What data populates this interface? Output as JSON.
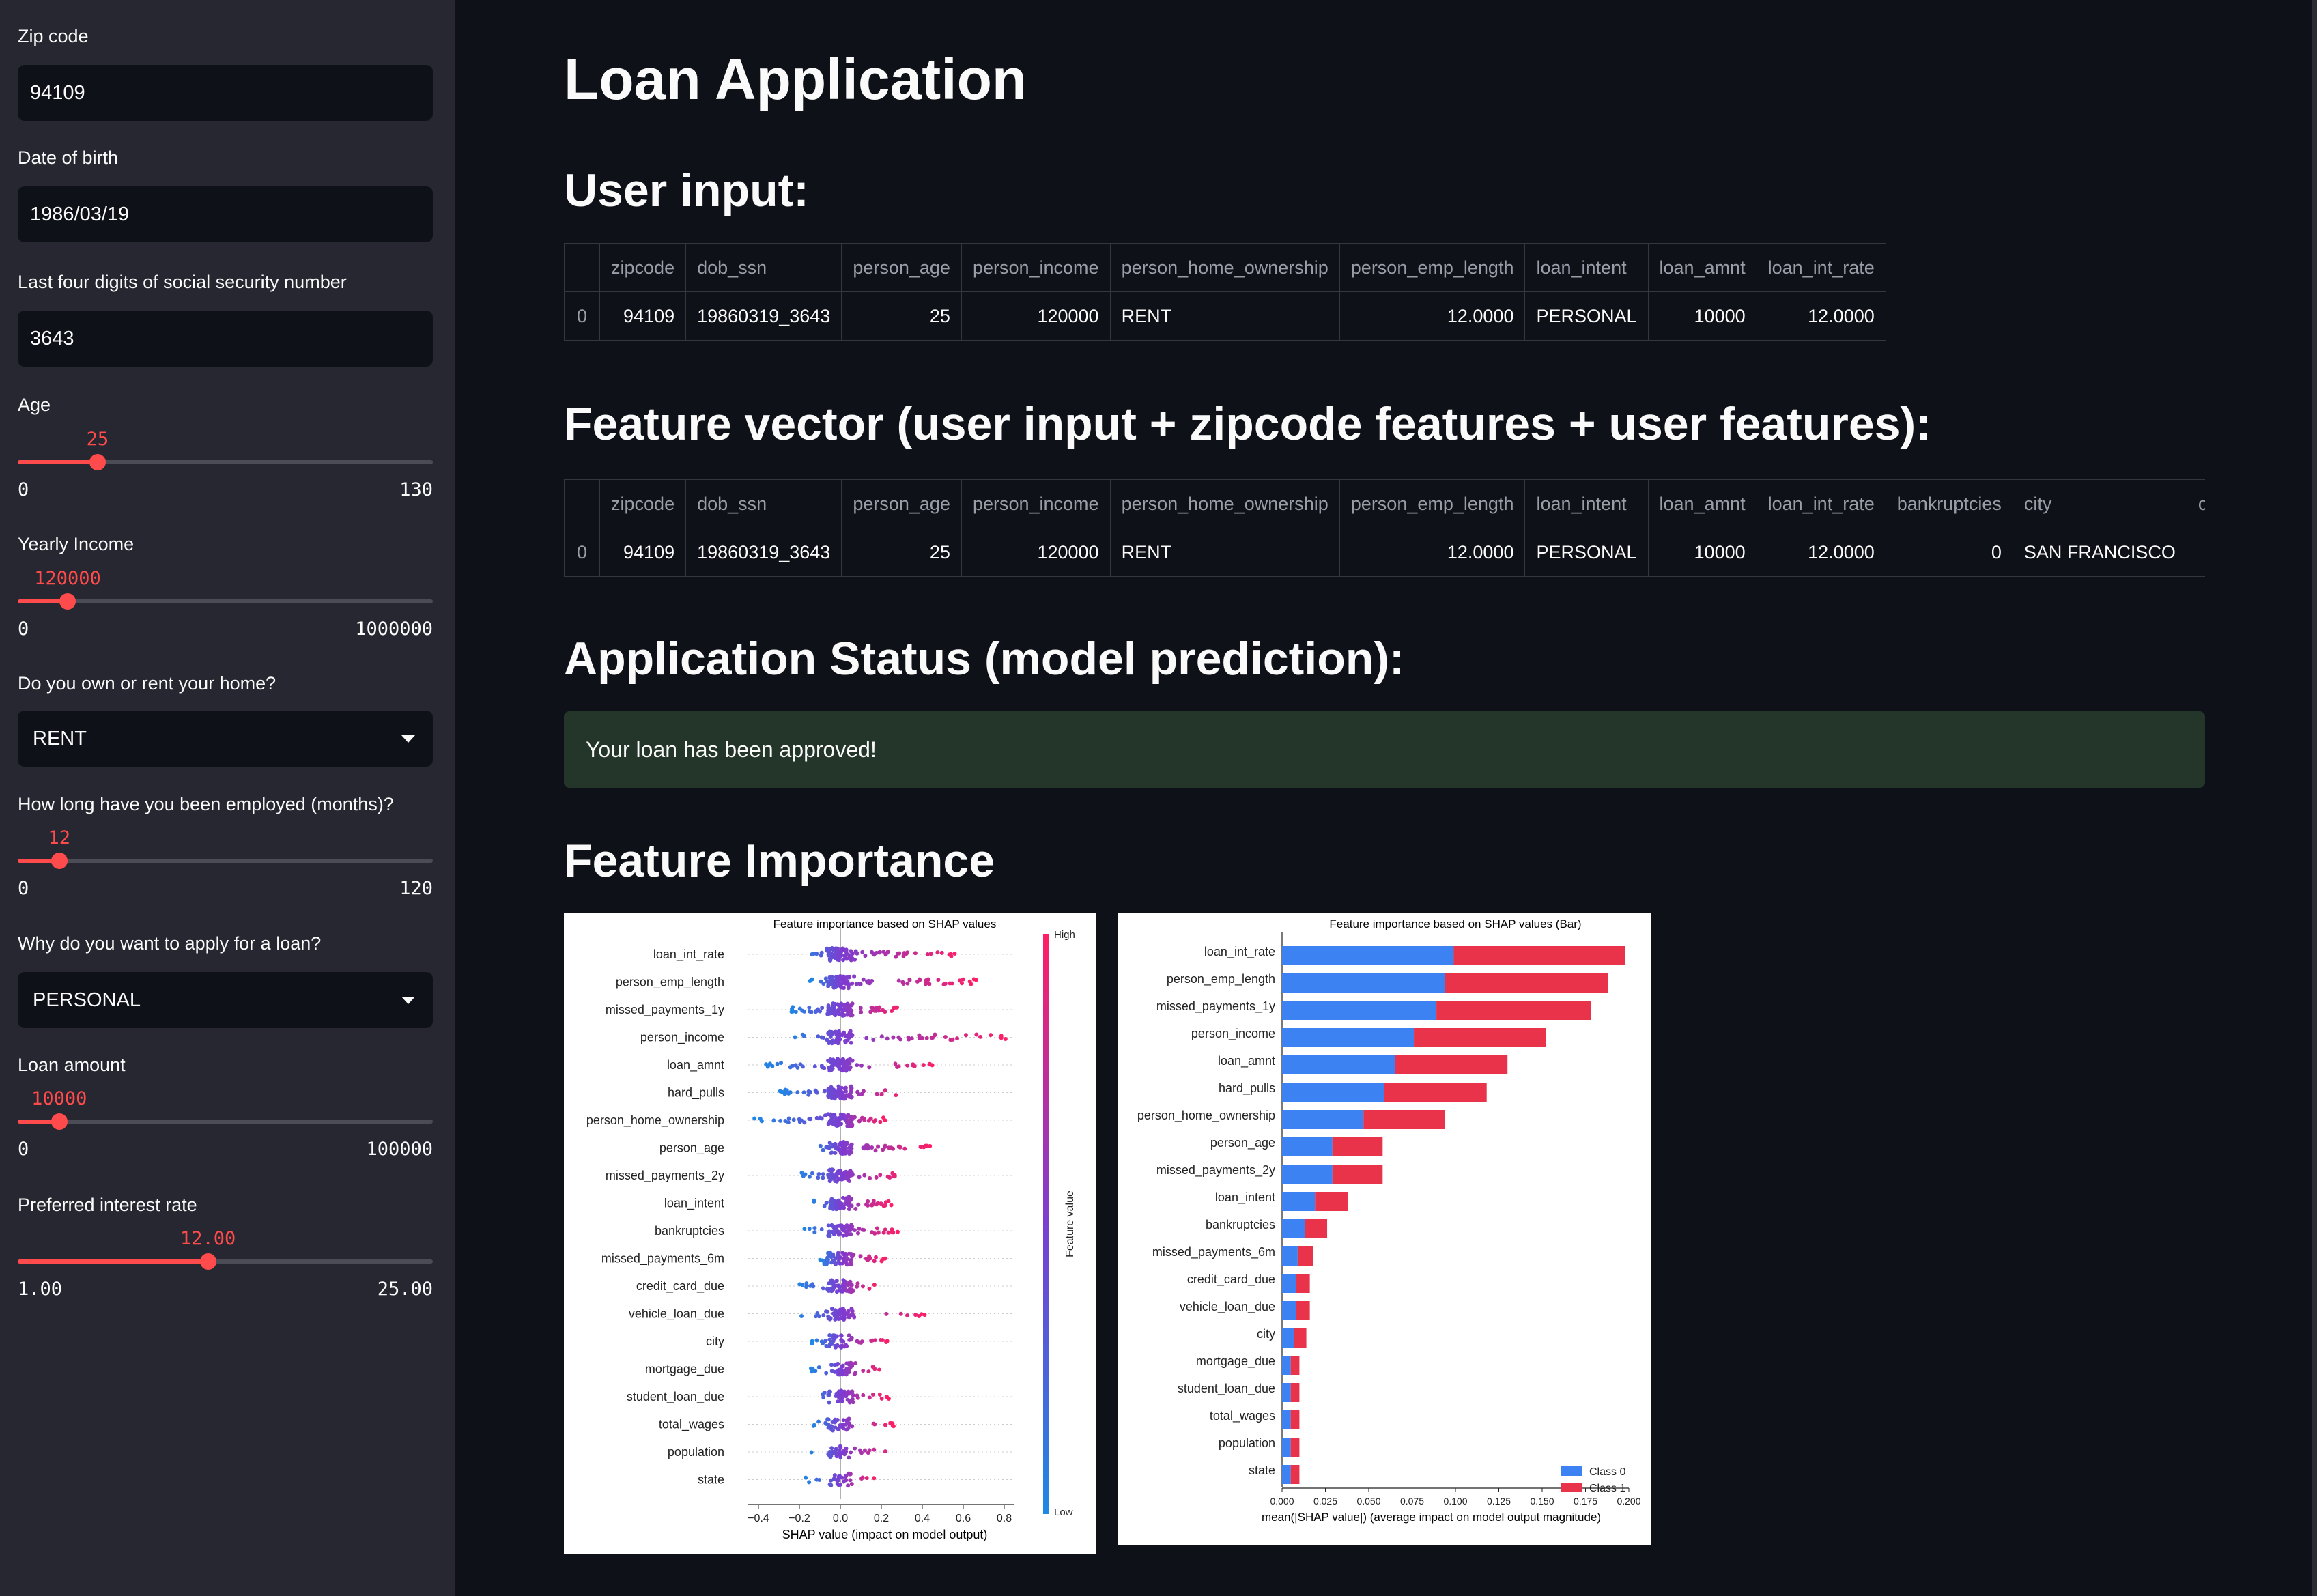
{
  "sidebar": {
    "zip": {
      "label": "Zip code",
      "value": "94109"
    },
    "dob": {
      "label": "Date of birth",
      "value": "1986/03/19"
    },
    "ssn": {
      "label": "Last four digits of social security number",
      "value": "3643"
    },
    "age": {
      "label": "Age",
      "value": "25",
      "min": "0",
      "max": "130",
      "fraction": 0.1923
    },
    "income": {
      "label": "Yearly Income",
      "value": "120000",
      "min": "0",
      "max": "1000000",
      "fraction": 0.12
    },
    "home": {
      "label": "Do you own or rent your home?",
      "value": "RENT"
    },
    "employed": {
      "label": "How long have you been employed (months)?",
      "value": "12",
      "min": "0",
      "max": "120",
      "fraction": 0.1
    },
    "intent": {
      "label": "Why do you want to apply for a loan?",
      "value": "PERSONAL"
    },
    "loan": {
      "label": "Loan amount",
      "value": "10000",
      "min": "0",
      "max": "100000",
      "fraction": 0.1
    },
    "rate": {
      "label": "Preferred interest rate",
      "value": "12.00",
      "min": "1.00",
      "max": "25.00",
      "fraction": 0.4583
    }
  },
  "main": {
    "title": "Loan Application",
    "user_input_heading": "User input:",
    "feature_vector_heading": "Feature vector (user input + zipcode features + user features):",
    "status_heading": "Application Status (model prediction):",
    "status_message": "Your loan has been approved!",
    "importance_heading": "Feature Importance"
  },
  "user_table": {
    "columns": [
      "",
      "zipcode",
      "dob_ssn",
      "person_age",
      "person_income",
      "person_home_ownership",
      "person_emp_length",
      "loan_intent",
      "loan_amnt",
      "loan_int_rate"
    ],
    "rows": [
      [
        "0",
        "94109",
        "19860319_3643",
        "25",
        "120000",
        "RENT",
        "12.0000",
        "PERSONAL",
        "10000",
        "12.0000"
      ]
    ]
  },
  "feature_table": {
    "columns": [
      "",
      "zipcode",
      "dob_ssn",
      "person_age",
      "person_income",
      "person_home_ownership",
      "person_emp_length",
      "loan_intent",
      "loan_amnt",
      "loan_int_rate",
      "bankruptcies",
      "city",
      "credit"
    ],
    "rows": [
      [
        "0",
        "94109",
        "19860319_3643",
        "25",
        "120000",
        "RENT",
        "12.0000",
        "PERSONAL",
        "10000",
        "12.0000",
        "0",
        "SAN FRANCISCO",
        ""
      ]
    ]
  },
  "colors": {
    "accent": "#ff4b4b",
    "class0": "#3c82f2",
    "class1": "#e8334a",
    "success_bg": "#233629"
  },
  "chart_data": [
    {
      "type": "scatter",
      "title": "Feature importance based on SHAP values",
      "xlabel": "SHAP value (impact on model output)",
      "xlim": [
        -0.45,
        0.85
      ],
      "xticks": [
        "−0.4",
        "−0.2",
        "0.0",
        "0.2",
        "0.4",
        "0.6",
        "0.8"
      ],
      "colorbar_label": "Feature value",
      "colorbar_high": "High",
      "colorbar_low": "Low",
      "features": [
        "loan_int_rate",
        "person_emp_length",
        "missed_payments_1y",
        "person_income",
        "loan_amnt",
        "hard_pulls",
        "person_home_ownership",
        "person_age",
        "missed_payments_2y",
        "loan_intent",
        "bankruptcies",
        "missed_payments_6m",
        "credit_card_due",
        "vehicle_loan_due",
        "city",
        "mortgage_due",
        "student_loan_due",
        "total_wages",
        "population",
        "state"
      ],
      "spread": [
        [
          -0.2,
          0.6
        ],
        [
          -0.15,
          0.67
        ],
        [
          -0.25,
          0.3
        ],
        [
          -0.25,
          0.82
        ],
        [
          -0.38,
          0.46
        ],
        [
          -0.3,
          0.32
        ],
        [
          -0.42,
          0.22
        ],
        [
          -0.15,
          0.45
        ],
        [
          -0.22,
          0.32
        ],
        [
          -0.15,
          0.26
        ],
        [
          -0.18,
          0.28
        ],
        [
          -0.1,
          0.22
        ],
        [
          -0.22,
          0.18
        ],
        [
          -0.22,
          0.43
        ],
        [
          -0.14,
          0.24
        ],
        [
          -0.15,
          0.22
        ],
        [
          -0.16,
          0.24
        ],
        [
          -0.14,
          0.26
        ],
        [
          -0.16,
          0.3
        ],
        [
          -0.18,
          0.17
        ]
      ]
    },
    {
      "type": "bar",
      "title": "Feature importance based on SHAP values (Bar)",
      "xlabel": "mean(|SHAP value|) (average impact on model output magnitude)",
      "xlim": [
        0,
        0.2
      ],
      "xticks": [
        "0.000",
        "0.025",
        "0.050",
        "0.075",
        "0.100",
        "0.125",
        "0.150",
        "0.175",
        "0.200"
      ],
      "categories": [
        "loan_int_rate",
        "person_emp_length",
        "missed_payments_1y",
        "person_income",
        "loan_amnt",
        "hard_pulls",
        "person_home_ownership",
        "person_age",
        "missed_payments_2y",
        "loan_intent",
        "bankruptcies",
        "missed_payments_6m",
        "credit_card_due",
        "vehicle_loan_due",
        "city",
        "mortgage_due",
        "student_loan_due",
        "total_wages",
        "population",
        "state"
      ],
      "series": [
        {
          "name": "Class 0",
          "values": [
            0.099,
            0.094,
            0.089,
            0.076,
            0.065,
            0.059,
            0.047,
            0.029,
            0.029,
            0.019,
            0.013,
            0.009,
            0.008,
            0.008,
            0.007,
            0.005,
            0.005,
            0.005,
            0.005,
            0.005
          ]
        },
        {
          "name": "Class 1",
          "values": [
            0.099,
            0.094,
            0.089,
            0.076,
            0.065,
            0.059,
            0.047,
            0.029,
            0.029,
            0.019,
            0.013,
            0.009,
            0.008,
            0.008,
            0.007,
            0.005,
            0.005,
            0.005,
            0.005,
            0.005
          ]
        }
      ]
    }
  ]
}
